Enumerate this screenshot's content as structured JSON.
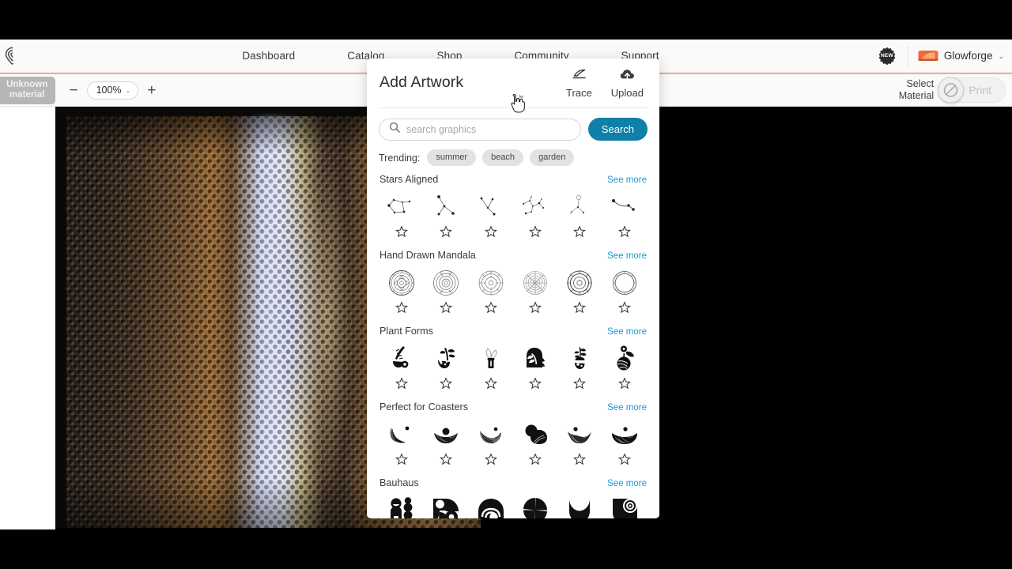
{
  "app": {
    "brand_logo": "glowforge-logo-icon",
    "accent_orange": "#f0b093",
    "accent_teal": "#0f80a8",
    "link_blue": "#1b9ad6"
  },
  "topbar": {
    "nav": [
      {
        "label": "Dashboard"
      },
      {
        "label": "Catalog"
      },
      {
        "label": "Shop"
      },
      {
        "label": "Community"
      },
      {
        "label": "Support"
      }
    ],
    "new_badge": "NEW",
    "account_name": "Glowforge",
    "account_chevron": "⌄"
  },
  "toolbar": {
    "material_line1": "Unknown",
    "material_line2": "material",
    "zoom_out": "−",
    "zoom_value": "100%",
    "zoom_chevron": "⌄",
    "zoom_in": "+",
    "select_material_line1": "Select",
    "select_material_line2": "Material",
    "print_label": "Print"
  },
  "panel": {
    "title": "Add Artwork",
    "actions": [
      {
        "label": "Trace",
        "icon": "trace-icon"
      },
      {
        "label": "Upload",
        "icon": "upload-icon"
      }
    ],
    "search": {
      "placeholder": "search graphics",
      "value": "",
      "button_label": "Search",
      "icon": "search-icon"
    },
    "trending": {
      "label": "Trending:",
      "tags": [
        "summer",
        "beach",
        "garden"
      ]
    },
    "see_more_label": "See more",
    "sections": [
      {
        "title": "Stars Aligned",
        "see_more": "See more",
        "items": [
          {
            "name": "constellation-1"
          },
          {
            "name": "constellation-2"
          },
          {
            "name": "constellation-3"
          },
          {
            "name": "constellation-4"
          },
          {
            "name": "constellation-5"
          },
          {
            "name": "constellation-6"
          }
        ]
      },
      {
        "title": "Hand Drawn Mandala",
        "see_more": "See more",
        "items": [
          {
            "name": "mandala-1"
          },
          {
            "name": "mandala-2"
          },
          {
            "name": "mandala-3"
          },
          {
            "name": "mandala-4"
          },
          {
            "name": "mandala-5"
          },
          {
            "name": "mandala-6"
          }
        ]
      },
      {
        "title": "Plant Forms",
        "see_more": "See more",
        "items": [
          {
            "name": "plant-fern-pot"
          },
          {
            "name": "plant-sprout-vase"
          },
          {
            "name": "plant-candle-leaf"
          },
          {
            "name": "plant-arch-frond"
          },
          {
            "name": "plant-bud-stem"
          },
          {
            "name": "plant-flower-orb"
          }
        ]
      },
      {
        "title": "Perfect for Coasters",
        "see_more": "See more",
        "items": [
          {
            "name": "coaster-wave-dot"
          },
          {
            "name": "coaster-bowl-sun"
          },
          {
            "name": "coaster-half-moon"
          },
          {
            "name": "coaster-hill-sun"
          },
          {
            "name": "coaster-peaks-dot"
          },
          {
            "name": "coaster-dome-dot"
          }
        ]
      },
      {
        "title": "Bauhaus",
        "see_more": "See more",
        "items": [
          {
            "name": "bauhaus-figure-dots"
          },
          {
            "name": "bauhaus-circle-quarters"
          },
          {
            "name": "bauhaus-arch-rainbow"
          },
          {
            "name": "bauhaus-pinwheel"
          },
          {
            "name": "bauhaus-tulip"
          },
          {
            "name": "bauhaus-spiral-leaf"
          }
        ]
      }
    ]
  },
  "canvas": {
    "bed_description": "honeycomb crumb tray bed camera view"
  }
}
